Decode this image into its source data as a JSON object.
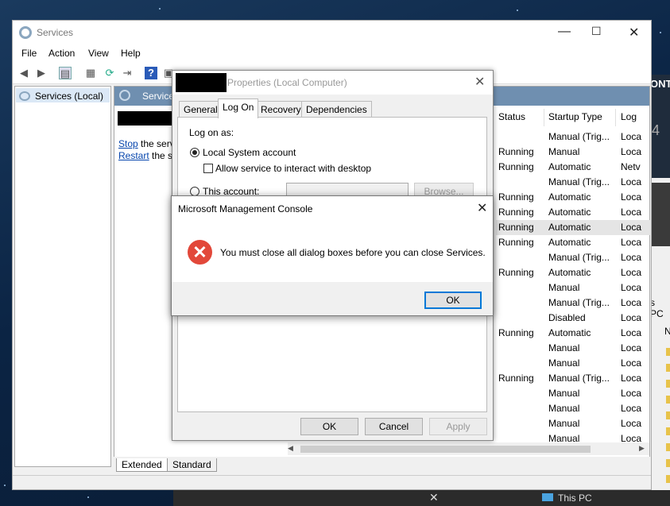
{
  "services_window": {
    "title": "Services",
    "menu": [
      "File",
      "Action",
      "View",
      "Help"
    ],
    "tree_item": "Services (Local)",
    "pane_header": "Services",
    "desc_stop_link": "Stop",
    "desc_stop_rest": " the serv",
    "desc_restart_link": "Restart",
    "desc_restart_rest": " the se",
    "columns": [
      "Status",
      "Startup Type",
      "Log"
    ],
    "rows": [
      {
        "status": "",
        "startup": "Manual (Trig...",
        "log": "Loca"
      },
      {
        "status": "Running",
        "startup": "Manual",
        "log": "Loca"
      },
      {
        "status": "Running",
        "startup": "Automatic",
        "log": "Netv"
      },
      {
        "status": "",
        "startup": "Manual (Trig...",
        "log": "Loca"
      },
      {
        "status": "Running",
        "startup": "Automatic",
        "log": "Loca"
      },
      {
        "status": "Running",
        "startup": "Automatic",
        "log": "Loca"
      },
      {
        "status": "Running",
        "startup": "Automatic",
        "log": "Loca"
      },
      {
        "status": "Running",
        "startup": "Automatic",
        "log": "Loca"
      },
      {
        "status": "",
        "startup": "Manual (Trig...",
        "log": "Loca"
      },
      {
        "status": "Running",
        "startup": "Automatic",
        "log": "Loca"
      },
      {
        "status": "",
        "startup": "Manual",
        "log": "Loca"
      },
      {
        "status": "",
        "startup": "Manual (Trig...",
        "log": "Loca"
      },
      {
        "status": "",
        "startup": "Disabled",
        "log": "Loca"
      },
      {
        "status": "Running",
        "startup": "Automatic",
        "log": "Loca"
      },
      {
        "status": "",
        "startup": "Manual",
        "log": "Loca"
      },
      {
        "status": "",
        "startup": "Manual",
        "log": "Loca"
      },
      {
        "status": "Running",
        "startup": "Manual (Trig...",
        "log": "Loca"
      },
      {
        "status": "",
        "startup": "Manual",
        "log": "Loca"
      },
      {
        "status": "",
        "startup": "Manual",
        "log": "Loca"
      },
      {
        "status": "",
        "startup": "Manual",
        "log": "Loca"
      },
      {
        "status": "",
        "startup": "Manual",
        "log": "Loca"
      }
    ],
    "bottom_tabs": [
      "Extended",
      "Standard"
    ]
  },
  "properties_dialog": {
    "title": "Properties (Local Computer)",
    "tabs": [
      "General",
      "Log On",
      "Recovery",
      "Dependencies"
    ],
    "active_tab": "Log On",
    "logon_as": "Log on as:",
    "local_system": "Local System account",
    "allow_interact": "Allow service to interact with desktop",
    "this_account": "This account:",
    "browse": "Browse...",
    "ok": "OK",
    "cancel": "Cancel",
    "apply": "Apply"
  },
  "message_box": {
    "title": "Microsoft Management Console",
    "message": "You must close all dialog boxes before you can close Services.",
    "ok": "OK"
  },
  "background_window": {
    "text_top": "ONT",
    "num": "4",
    "text_ps": "s PC",
    "text_n": "N"
  },
  "taskbar": {
    "text_this_pc": "This PC"
  }
}
